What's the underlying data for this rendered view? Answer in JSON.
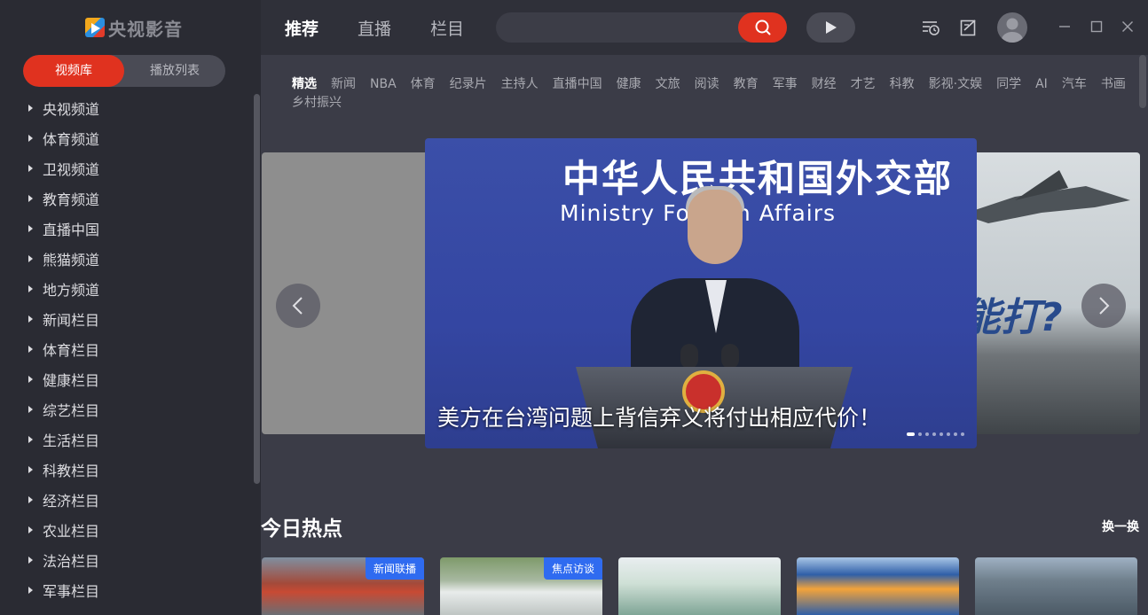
{
  "app": {
    "logo_text": "央视影音"
  },
  "colors": {
    "accent": "#e0321f",
    "tag_blue": "#2f6bf0",
    "sidebar_bg": "#2a2b33",
    "main_bg": "#3b3c47"
  },
  "sidebar": {
    "tabs": [
      {
        "label": "视频库",
        "active": true
      },
      {
        "label": "播放列表",
        "active": false
      }
    ],
    "items": [
      "央视频道",
      "体育频道",
      "卫视频道",
      "教育频道",
      "直播中国",
      "熊猫频道",
      "地方频道",
      "新闻栏目",
      "体育栏目",
      "健康栏目",
      "综艺栏目",
      "生活栏目",
      "科教栏目",
      "经济栏目",
      "农业栏目",
      "法治栏目",
      "军事栏目"
    ]
  },
  "topbar": {
    "tabs": [
      {
        "label": "推荐",
        "active": true
      },
      {
        "label": "直播",
        "active": false
      },
      {
        "label": "栏目",
        "active": false
      }
    ],
    "search": {
      "value": "",
      "placeholder": ""
    },
    "icons": [
      "search-icon",
      "play-icon",
      "history-icon",
      "edit-icon",
      "user-avatar",
      "minimize-icon",
      "maximize-icon",
      "close-icon"
    ]
  },
  "categories": [
    "精选",
    "新闻",
    "NBA",
    "体育",
    "纪录片",
    "主持人",
    "直播中国",
    "健康",
    "文旅",
    "阅读",
    "教育",
    "军事",
    "财经",
    "才艺",
    "科教",
    "影视·文娱",
    "同学",
    "AI",
    "汽车",
    "书画",
    "乡村振兴"
  ],
  "carousel": {
    "caption": "美方在台湾问题上背信弃义将付出相应代价！",
    "backdrop_title": "中华人民共和国外交部",
    "backdrop_subtitle": "Ministry   Foreign Affairs",
    "right_slide_text": "能打?",
    "dot_count": 8,
    "active_dot": 0
  },
  "hot_section": {
    "title": "今日热点",
    "refresh_label": "换一换",
    "thumbs": [
      {
        "tag": "新闻联播"
      },
      {
        "tag": "焦点访谈"
      },
      {
        "tag": ""
      },
      {
        "tag": ""
      },
      {
        "tag": ""
      }
    ]
  }
}
